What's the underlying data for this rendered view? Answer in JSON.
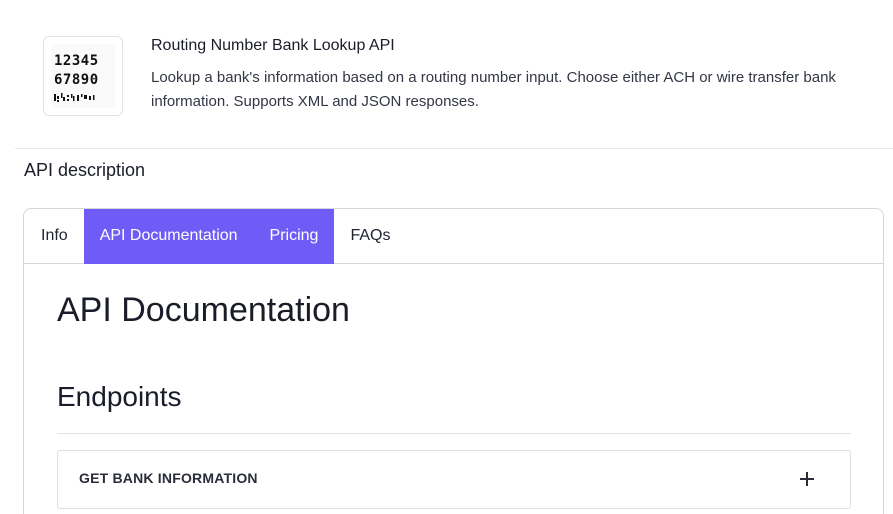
{
  "product": {
    "title": "Routing Number Bank Lookup API",
    "description": "Lookup a bank's information based on a routing number input. Choose either ACH or wire transfer bank information. Supports XML and JSON responses.",
    "logo": {
      "icon": "routing-number-logo-icon",
      "line1": "12345",
      "line2": "67890"
    }
  },
  "section": {
    "label": "API description"
  },
  "tabs": [
    {
      "label": "Info",
      "active": false
    },
    {
      "label": "API Documentation",
      "active": true
    },
    {
      "label": "Pricing",
      "active": true
    },
    {
      "label": "FAQs",
      "active": false
    }
  ],
  "docs": {
    "title": "API Documentation",
    "endpoints_title": "Endpoints",
    "endpoints": [
      {
        "label": "GET BANK INFORMATION",
        "icon": "plus-icon"
      }
    ]
  },
  "colors": {
    "accent": "#6f5cf6",
    "text": "#1a1d29",
    "border": "#d6d6db"
  }
}
